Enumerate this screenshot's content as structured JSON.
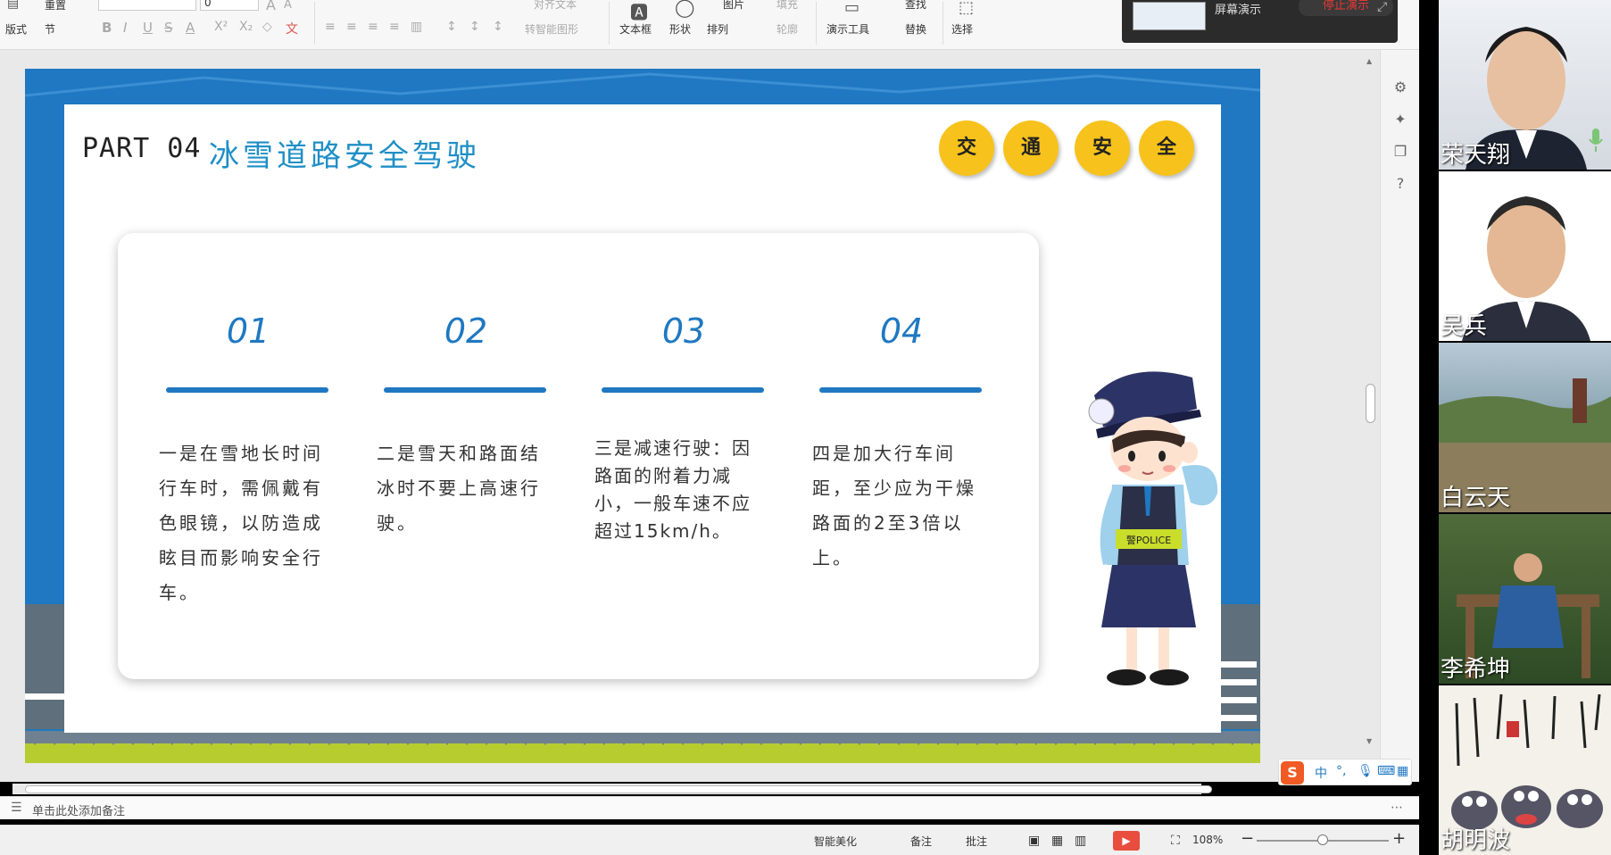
{
  "ribbon": {
    "redo": "重置",
    "layout": "版式",
    "section": "节",
    "font_size": "0",
    "font_grow": "A",
    "font_shrink": "A",
    "bold": "B",
    "italic": "I",
    "underline": "U",
    "strike": "S",
    "font_color": "A",
    "superscript": "X²",
    "subscript": "X₂",
    "clear": "◇",
    "phonetic": "文",
    "align_text": "对齐文本",
    "convert_smartart": "转智能图形",
    "textbox": "文本框",
    "shape": "形状",
    "arrange": "排列",
    "picture": "图片",
    "fill": "填充",
    "outline": "轮廓",
    "presentation_tools": "演示工具",
    "find": "查找",
    "replace": "替换",
    "select": "选择"
  },
  "share_bar": {
    "label": "屏幕演示",
    "stop": "停止演示"
  },
  "slide": {
    "part_label": "PART 04",
    "title": "冰雪道路安全驾驶",
    "badges": [
      "交",
      "通",
      "安",
      "全"
    ],
    "columns": [
      {
        "num": "01",
        "text": "一是在雪地长时间行车时，需佩戴有色眼镜，以防造成眩目而影响安全行车。"
      },
      {
        "num": "02",
        "text": "二是雪天和路面结冰时不要上高速行驶。"
      },
      {
        "num": "03",
        "text": "三是减速行驶：因路面的附着力减小，一般车速不应超过15km/h。"
      },
      {
        "num": "04",
        "text": "四是加大行车间距，至少应为干燥路面的2至3倍以上。"
      }
    ],
    "police_badge": "警POLICE"
  },
  "notes": {
    "placeholder": "单击此处添加备注"
  },
  "status": {
    "beautify": "智能美化",
    "remarks": "备注",
    "comment": "批注",
    "zoom": "108%",
    "zoom_minus": "−",
    "zoom_plus": "+"
  },
  "ime": {
    "logo": "S",
    "lang": "中",
    "punct": "°,"
  },
  "participants": [
    {
      "name": "荣天翔"
    },
    {
      "name": "吴兵"
    },
    {
      "name": "白云天"
    },
    {
      "name": "李希坤"
    },
    {
      "name": "胡明波"
    }
  ],
  "colors": {
    "slide_blue": "#1f78c1",
    "title_blue": "#1f8fc6",
    "badge_yellow": "#f7c21b",
    "stop_red": "#e53935",
    "play_red": "#e84d3d"
  }
}
